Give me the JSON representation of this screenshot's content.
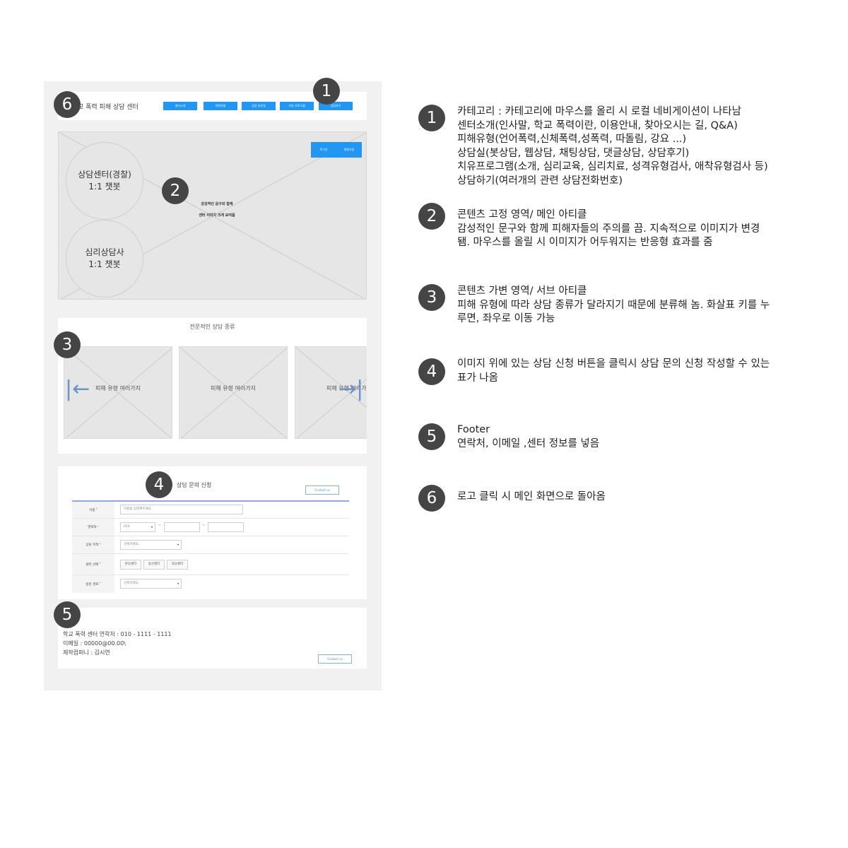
{
  "wireframe": {
    "header": {
      "logo": "교 폭력 피해 상담 센터",
      "nav": [
        "센터소개",
        "피해유형",
        "상담 자료실",
        "치유 프로그램",
        "상담하기"
      ]
    },
    "hero": {
      "circles": [
        {
          "line1": "상담센터(경찰)",
          "line2": "1:1 챗봇"
        },
        {
          "line1": "심리상담사",
          "line2": "1:1 챗봇"
        }
      ],
      "caption1": "감성적인 문구와 함께",
      "caption2": "센터 이미지 크게 보여줌",
      "buttons": [
        "로그인",
        "회원가입"
      ]
    },
    "types": {
      "title": "전문적인 상담 종류",
      "cards": [
        "피해 유형 여러가지",
        "피해 유형 여러가지",
        "피해 유형 여러가지"
      ],
      "arrow_left": "|←",
      "arrow_right": "→|"
    },
    "form": {
      "title": "상담 문의 신청",
      "contact_button": "Contact us",
      "rows": {
        "name": {
          "label": "이름",
          "placeholder": "이름을 입력해주세요."
        },
        "phone": {
          "label": "연락처",
          "prefix": "010",
          "dash": "~"
        },
        "category": {
          "label": "상담 목적",
          "value": "선택하세요."
        },
        "center": {
          "label": "센터 선택",
          "options": [
            "본당센터",
            "용산센터",
            "강남센터"
          ]
        },
        "route": {
          "label": "방문 경로",
          "value": "선택하세요."
        }
      },
      "required_mark": "*",
      "caret": "▾"
    },
    "footer": {
      "line1": "학교 폭력 센터 연락처 : 010 - 1111 - 1111",
      "line2": "이메일 : 00000@00.00\\",
      "line3": "제작컴퍼니 :  김시연",
      "contact_button": "Contact us"
    }
  },
  "badges": [
    "1",
    "2",
    "3",
    "4",
    "5",
    "6"
  ],
  "descriptions": [
    {
      "number": "1",
      "lines": [
        "카테고리 : 카테고리에 마우스를 올리 시 로컬 네비게이션이 나타남",
        "센터소개(인사말, 학교 폭력이란, 이용안내, 찾아오시는 길, Q&A)",
        "피해유형(언어폭력,신체폭력,성폭력, 따돌림, 강요 ...)",
        "상담실(봇상담, 웹상담, 채팅상담, 댓글상담, 상담후기)",
        "치유프로그램(소개, 심리교육, 심리치료, 성격유형검사, 애착유형검사 등)",
        "상담하기(여러개의 관련 상담전화번호)"
      ]
    },
    {
      "number": "2",
      "lines": [
        "콘텐츠 고정 영역/ 메인 아티클",
        "감성적인 문구와 함께 피해자들의 주의를 끔. 지속적으로 이미지가 변경",
        "됌. 마우스를 올릴 시 이미지가 어두워지는 반응형 효과를 줌"
      ]
    },
    {
      "number": "3",
      "lines": [
        "콘텐츠 가변 영역/ 서브 아티클",
        "피해 유형에 따라 상담 종류가 달라지기 때문에 분류해 놈. 화살표 키를 누",
        "루면, 좌우로 이동 가능"
      ]
    },
    {
      "number": "4",
      "lines": [
        "이미지 위에 있는 상담 신청 버튼을 클릭시 상담 문의 신청 작성할 수 있는",
        "표가 나옴"
      ]
    },
    {
      "number": "5",
      "lines": [
        "Footer",
        "연락처, 이메일 ,센터 정보를 넣음"
      ]
    },
    {
      "number": "6",
      "lines": [
        "로고 클릭 시 메인 화면으로 돌아옴"
      ]
    }
  ]
}
